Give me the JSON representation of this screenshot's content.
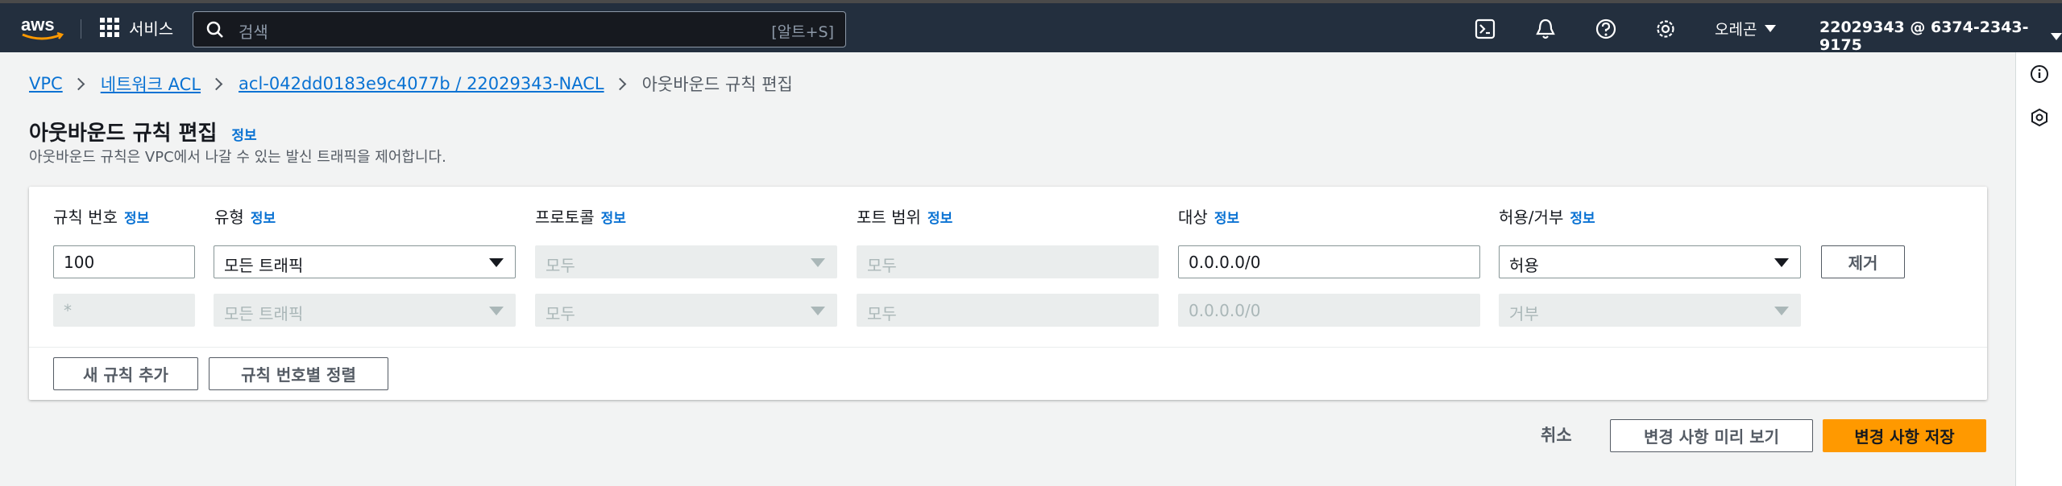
{
  "topnav": {
    "services_label": "서비스",
    "search_placeholder": "검색",
    "search_shortcut": "[알트+S]",
    "region": "오레곤",
    "account": "22029343 @ 6374-2343-9175",
    "icons": [
      "cloudshell-icon",
      "notifications-icon",
      "help-icon",
      "settings-icon"
    ]
  },
  "breadcrumb": {
    "items": [
      "VPC",
      "네트워크 ACL",
      "acl-042dd0183e9c4077b / 22029343-NACL"
    ],
    "current": "아웃바운드 규칙 편집"
  },
  "page": {
    "title": "아웃바운드 규칙 편집",
    "info": "정보",
    "description": "아웃바운드 규칙은 VPC에서 나갈 수 있는 발신 트래픽을 제어합니다."
  },
  "columns": [
    {
      "label": "규칙 번호",
      "info": "정보"
    },
    {
      "label": "유형",
      "info": "정보"
    },
    {
      "label": "프로토콜",
      "info": "정보"
    },
    {
      "label": "포트 범위",
      "info": "정보"
    },
    {
      "label": "대상",
      "info": "정보"
    },
    {
      "label": "허용/거부",
      "info": "정보"
    }
  ],
  "rules": [
    {
      "number": "100",
      "type": "모든 트래픽",
      "protocol": "모두",
      "port_range": "모두",
      "destination": "0.0.0.0/0",
      "allow_deny": "허용",
      "remove_label": "제거"
    },
    {
      "number": "*",
      "type": "모든 트래픽",
      "protocol": "모두",
      "port_range": "모두",
      "destination": "0.0.0.0/0",
      "allow_deny": "거부"
    }
  ],
  "actions": {
    "add_rule": "새 규칙 추가",
    "sort_rules": "규칙 번호별 정렬",
    "cancel": "취소",
    "preview": "변경 사항 미리 보기",
    "save": "변경 사항 저장"
  },
  "colors": {
    "nav_bg": "#232f3e",
    "link": "#0972d3",
    "primary": "#ff9900"
  }
}
